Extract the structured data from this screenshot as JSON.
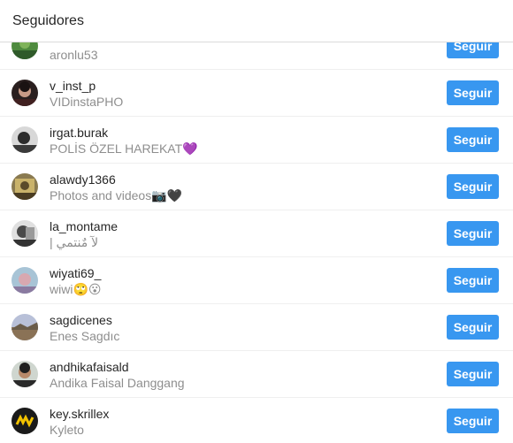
{
  "header": {
    "title": "Seguidores"
  },
  "followers": [
    {
      "username": "",
      "fullname": "aronlu53",
      "button": "Seguir",
      "avatar_color": "#3f7a3a"
    },
    {
      "username": "v_inst_p",
      "fullname": "VIDinstaPHO",
      "button": "Seguir",
      "avatar_color": "#3a2a2a"
    },
    {
      "username": "irgat.burak",
      "fullname": "POLİS ÖZEL HAREKAT💜",
      "button": "Seguir",
      "avatar_color": "#2c2c2c"
    },
    {
      "username": "alawdy1366",
      "fullname": "Photos and videos📷🖤",
      "button": "Seguir",
      "avatar_color": "#7a6a40"
    },
    {
      "username": "la_montame",
      "fullname": "| لآ مٌنتمي",
      "button": "Seguir",
      "avatar_color": "#555555"
    },
    {
      "username": "wiyati69_",
      "fullname": "wiwi🙄😮",
      "button": "Seguir",
      "avatar_color": "#9fb8c8"
    },
    {
      "username": "sagdicenes",
      "fullname": "Enes Sagdıc",
      "button": "Seguir",
      "avatar_color": "#8b7c6a"
    },
    {
      "username": "andhikafaisald",
      "fullname": "Andika Faisal Danggang",
      "button": "Seguir",
      "avatar_color": "#3a3a3a"
    },
    {
      "username": "key.skrillex",
      "fullname": "Kyleto",
      "button": "Seguir",
      "avatar_color": "#1f1f1f"
    }
  ],
  "colors": {
    "button": "#3897f0",
    "username": "#262626",
    "fullname": "#8e8e8e",
    "divider": "#efefef"
  }
}
